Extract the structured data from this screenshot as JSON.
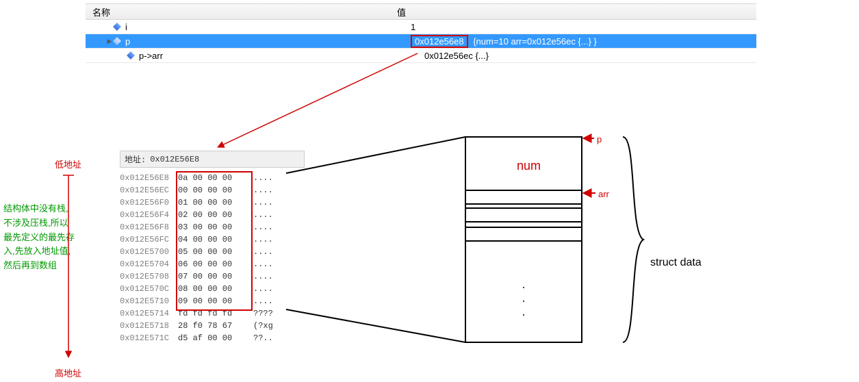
{
  "watch": {
    "header": {
      "name": "名称",
      "value": "值"
    },
    "rows": [
      {
        "name": "i",
        "value": "1"
      },
      {
        "name": "p",
        "value": "0x012e56e8",
        "extra": "{num=10 arr=0x012e56ec {...} }"
      },
      {
        "name": "p->arr",
        "value": "0x012e56ec {...}"
      }
    ]
  },
  "memory": {
    "addr_label": "地址:",
    "addr_value": "0x012E56E8",
    "rows": [
      {
        "off": "0x012E56E8",
        "bytes": "0a 00 00 00",
        "ascii": "...."
      },
      {
        "off": "0x012E56EC",
        "bytes": "00 00 00 00",
        "ascii": "...."
      },
      {
        "off": "0x012E56F0",
        "bytes": "01 00 00 00",
        "ascii": "...."
      },
      {
        "off": "0x012E56F4",
        "bytes": "02 00 00 00",
        "ascii": "...."
      },
      {
        "off": "0x012E56F8",
        "bytes": "03 00 00 00",
        "ascii": "...."
      },
      {
        "off": "0x012E56FC",
        "bytes": "04 00 00 00",
        "ascii": "...."
      },
      {
        "off": "0x012E5700",
        "bytes": "05 00 00 00",
        "ascii": "...."
      },
      {
        "off": "0x012E5704",
        "bytes": "06 00 00 00",
        "ascii": "...."
      },
      {
        "off": "0x012E5708",
        "bytes": "07 00 00 00",
        "ascii": "...."
      },
      {
        "off": "0x012E570C",
        "bytes": "08 00 00 00",
        "ascii": "...."
      },
      {
        "off": "0x012E5710",
        "bytes": "09 00 00 00",
        "ascii": "...."
      },
      {
        "off": "0x012E5714",
        "bytes": "fd fd fd fd",
        "ascii": "????"
      },
      {
        "off": "0x012E5718",
        "bytes": "28 f0 78 67",
        "ascii": "(?xg"
      },
      {
        "off": "0x012E571C",
        "bytes": "d5 af 00 00",
        "ascii": "??.."
      }
    ]
  },
  "annotations": {
    "low_addr": "低地址",
    "high_addr": "高地址",
    "green_text": "结构体中没有栈,不涉及压栈,所以最先定义的最先存入,先放入地址值,然后再到数组",
    "p": "p",
    "arr": "arr",
    "num": "num",
    "struct": "struct data"
  }
}
